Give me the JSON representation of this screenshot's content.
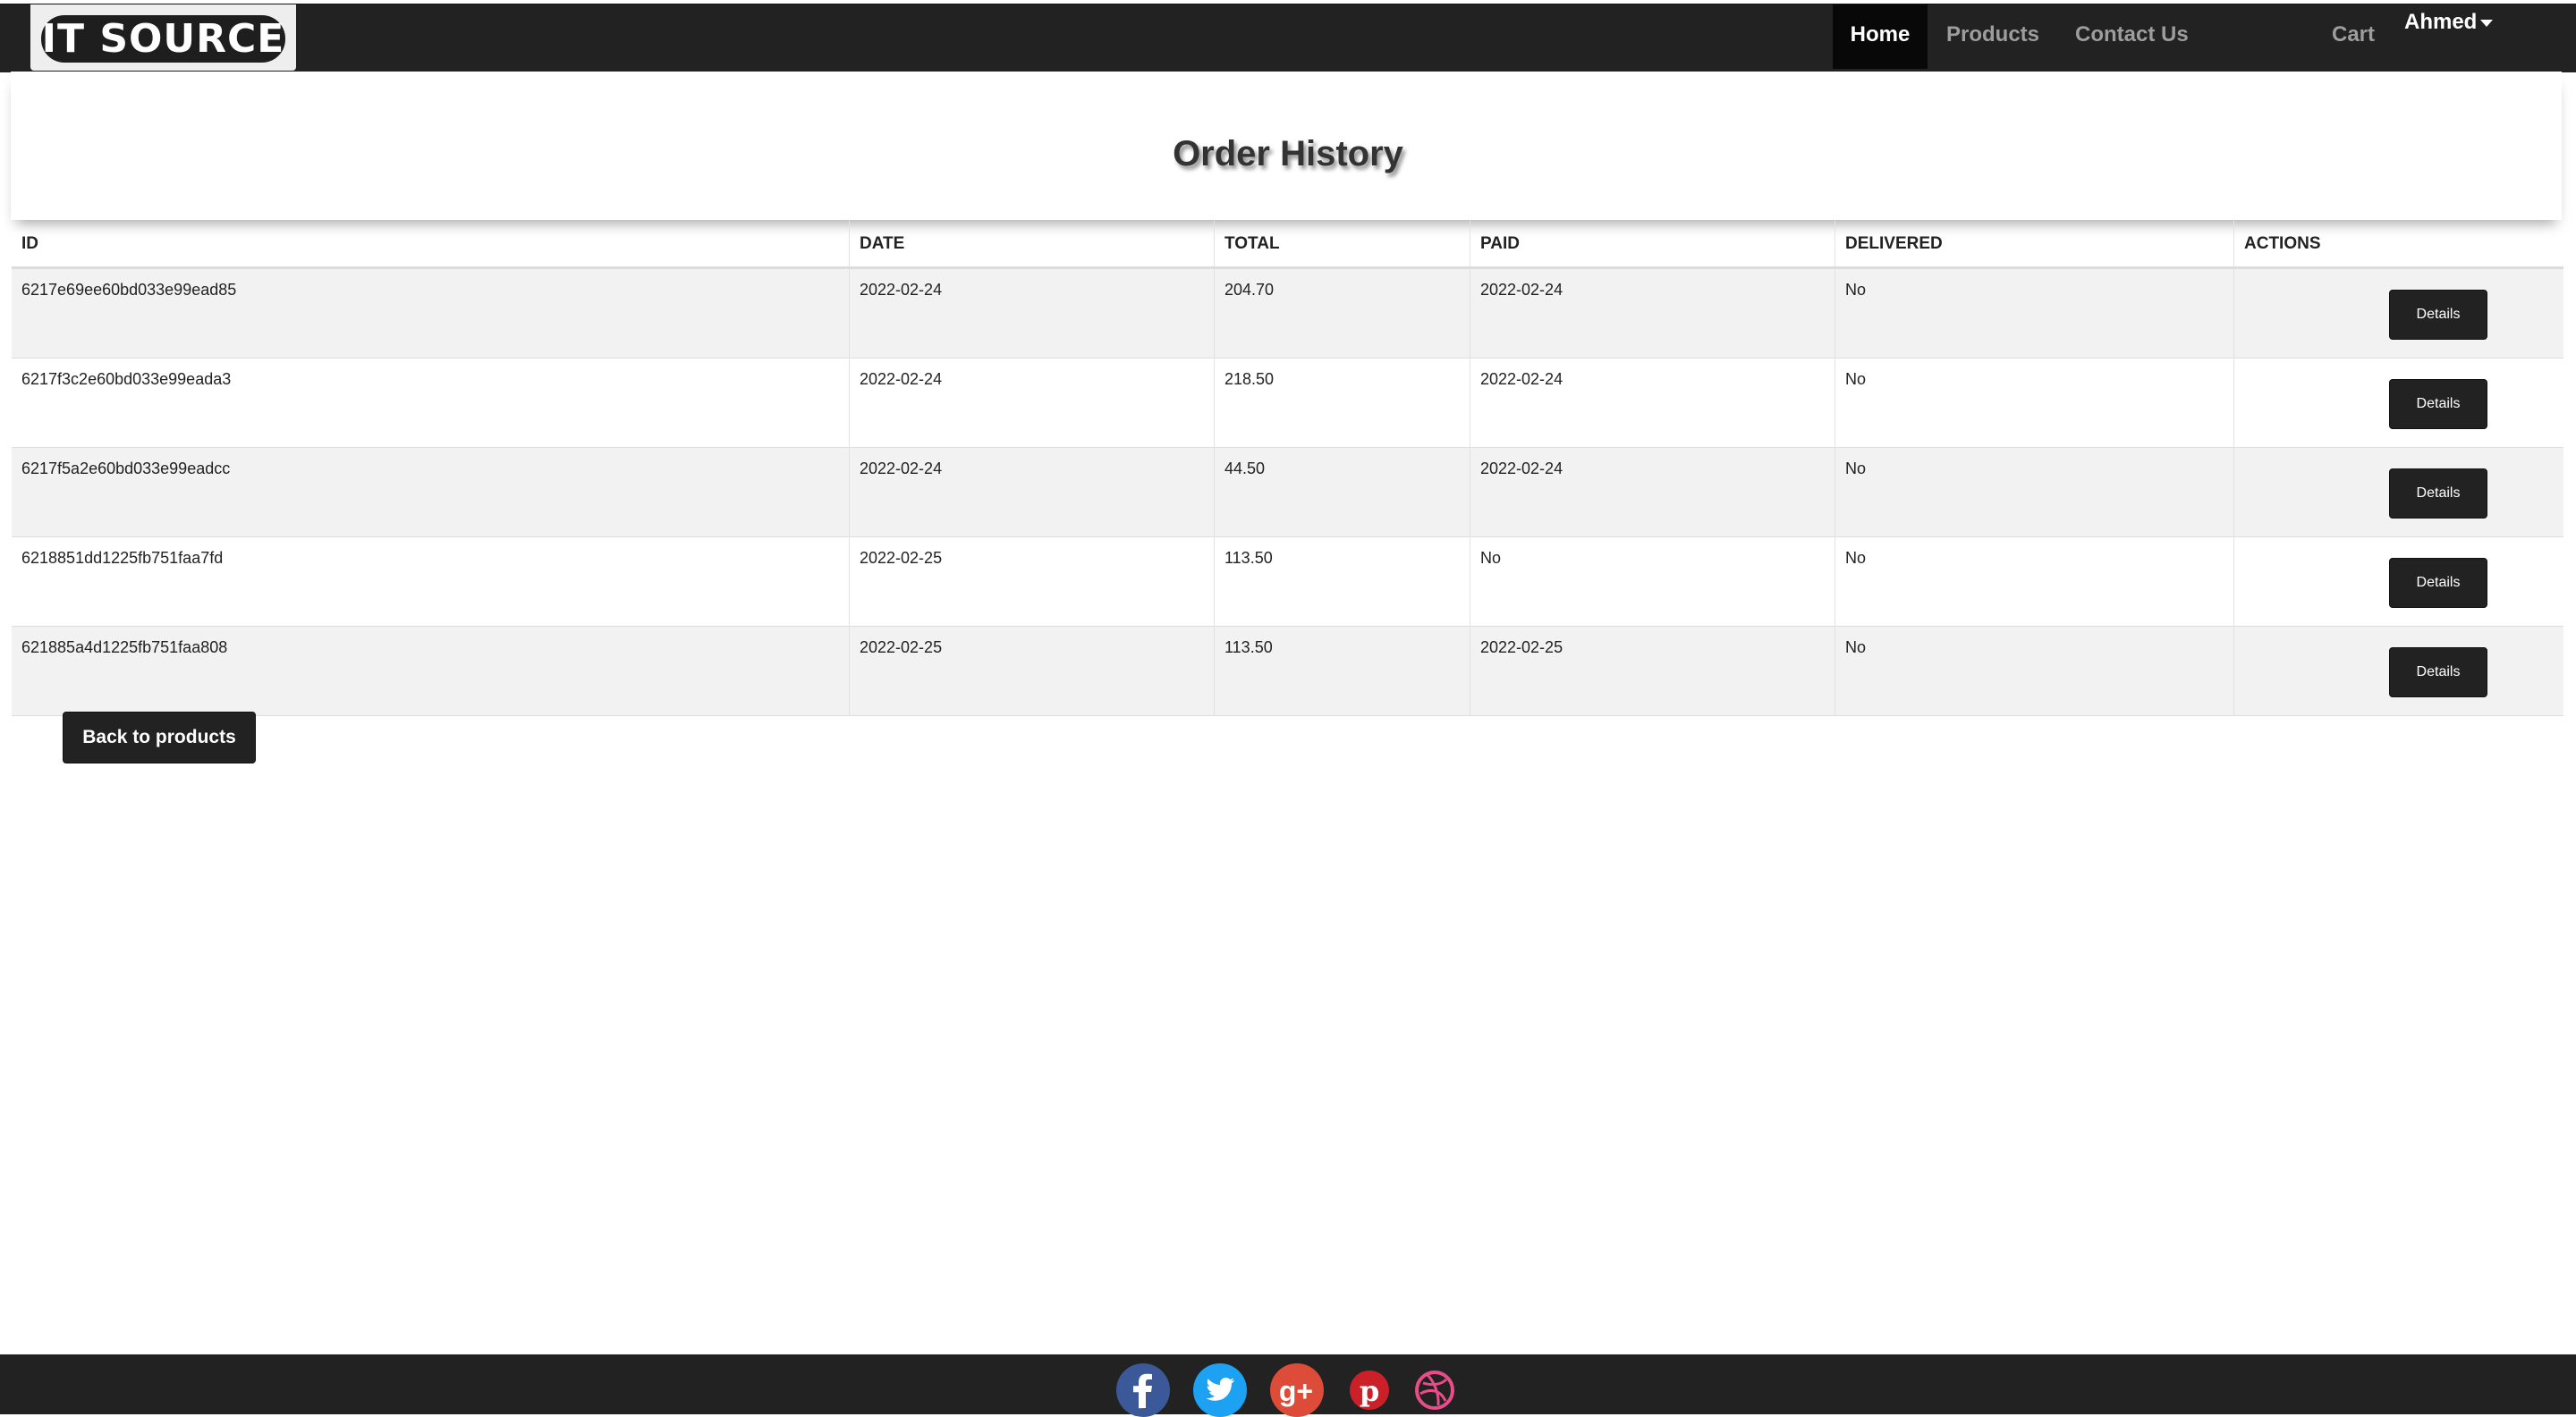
{
  "nav": {
    "brand": "IT SOURCE",
    "links": [
      "Home",
      "Products",
      "Contact Us"
    ],
    "cart": "Cart",
    "user": "Ahmed"
  },
  "page": {
    "title": "Order History"
  },
  "table": {
    "headers": [
      "ID",
      "DATE",
      "TOTAL",
      "PAID",
      "DELIVERED",
      "ACTIONS"
    ],
    "rows": [
      {
        "id": "6217e69ee60bd033e99ead85",
        "date": "2022-02-24",
        "total": "204.70",
        "paid": "2022-02-24",
        "delivered": "No",
        "action": "Details"
      },
      {
        "id": "6217f3c2e60bd033e99eada3",
        "date": "2022-02-24",
        "total": "218.50",
        "paid": "2022-02-24",
        "delivered": "No",
        "action": "Details"
      },
      {
        "id": "6217f5a2e60bd033e99eadcc",
        "date": "2022-02-24",
        "total": "44.50",
        "paid": "2022-02-24",
        "delivered": "No",
        "action": "Details"
      },
      {
        "id": "6218851dd1225fb751faa7fd",
        "date": "2022-02-25",
        "total": "113.50",
        "paid": "No",
        "delivered": "No",
        "action": "Details"
      },
      {
        "id": "621885a4d1225fb751faa808",
        "date": "2022-02-25",
        "total": "113.50",
        "paid": "2022-02-25",
        "delivered": "No",
        "action": "Details"
      }
    ]
  },
  "back_button": "Back to products",
  "footer": {
    "social_icons": [
      "facebook-icon",
      "twitter-icon",
      "google-plus-icon",
      "pinterest-icon",
      "dribbble-icon"
    ]
  },
  "colors": {
    "nav_bg": "#222222",
    "button_bg": "#222222",
    "row_stripe": "#f2f2f2",
    "facebook": "#3b5998",
    "twitter": "#1da1f2",
    "google_plus": "#dd4b39",
    "pinterest": "#cb2027",
    "dribbble": "#ea4c89"
  }
}
